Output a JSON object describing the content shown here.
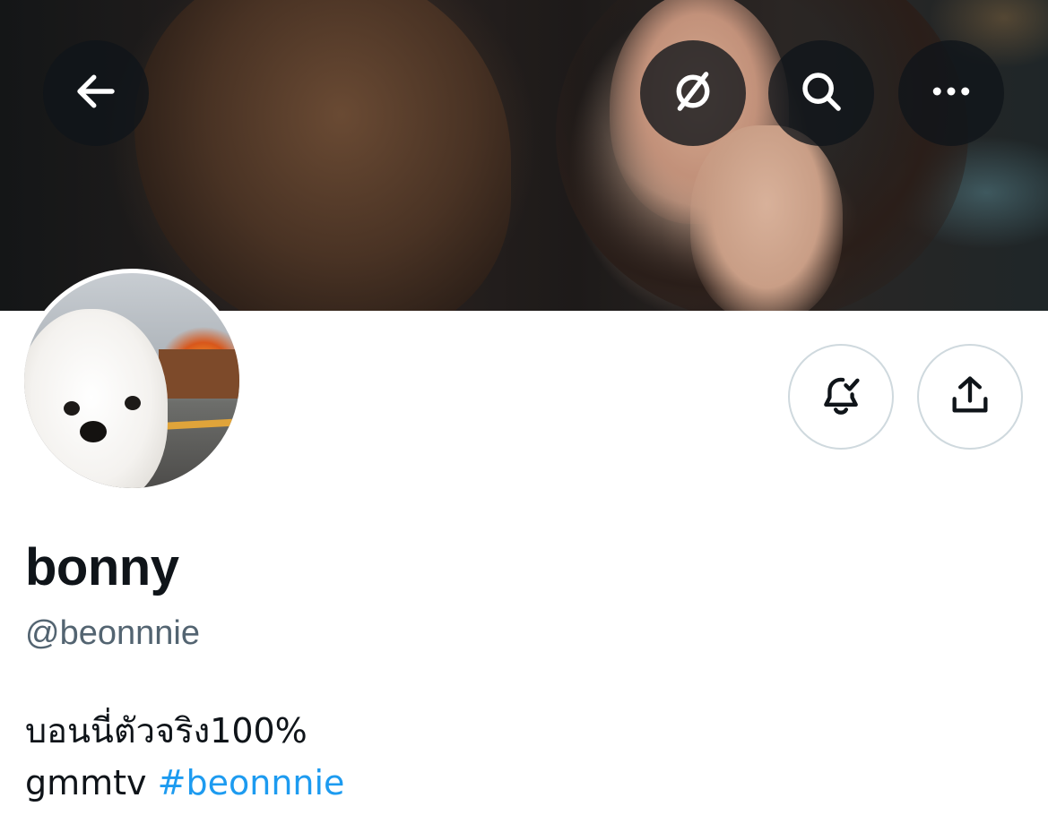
{
  "header": {
    "banner_image": "banner-photo",
    "back_icon": "arrow-left-icon",
    "translate_icon": "translate-slash-icon",
    "search_icon": "search-icon",
    "more_icon": "more-horizontal-icon"
  },
  "profile": {
    "avatar_image": "avatar-photo",
    "display_name": "bonny",
    "handle": "@beonnnie",
    "bio_line1": "บอนนี่ตัวจริง100%",
    "bio_line2_text": "gmmtv",
    "bio_hashtag": "#beonnnie"
  },
  "actions": {
    "notify_icon": "bell-check-icon",
    "share_icon": "share-icon"
  },
  "colors": {
    "text_primary": "#0f1419",
    "text_secondary": "#536471",
    "link": "#1d9bf0",
    "button_border": "#cfd9de",
    "overlay_button": "#0f1419"
  }
}
